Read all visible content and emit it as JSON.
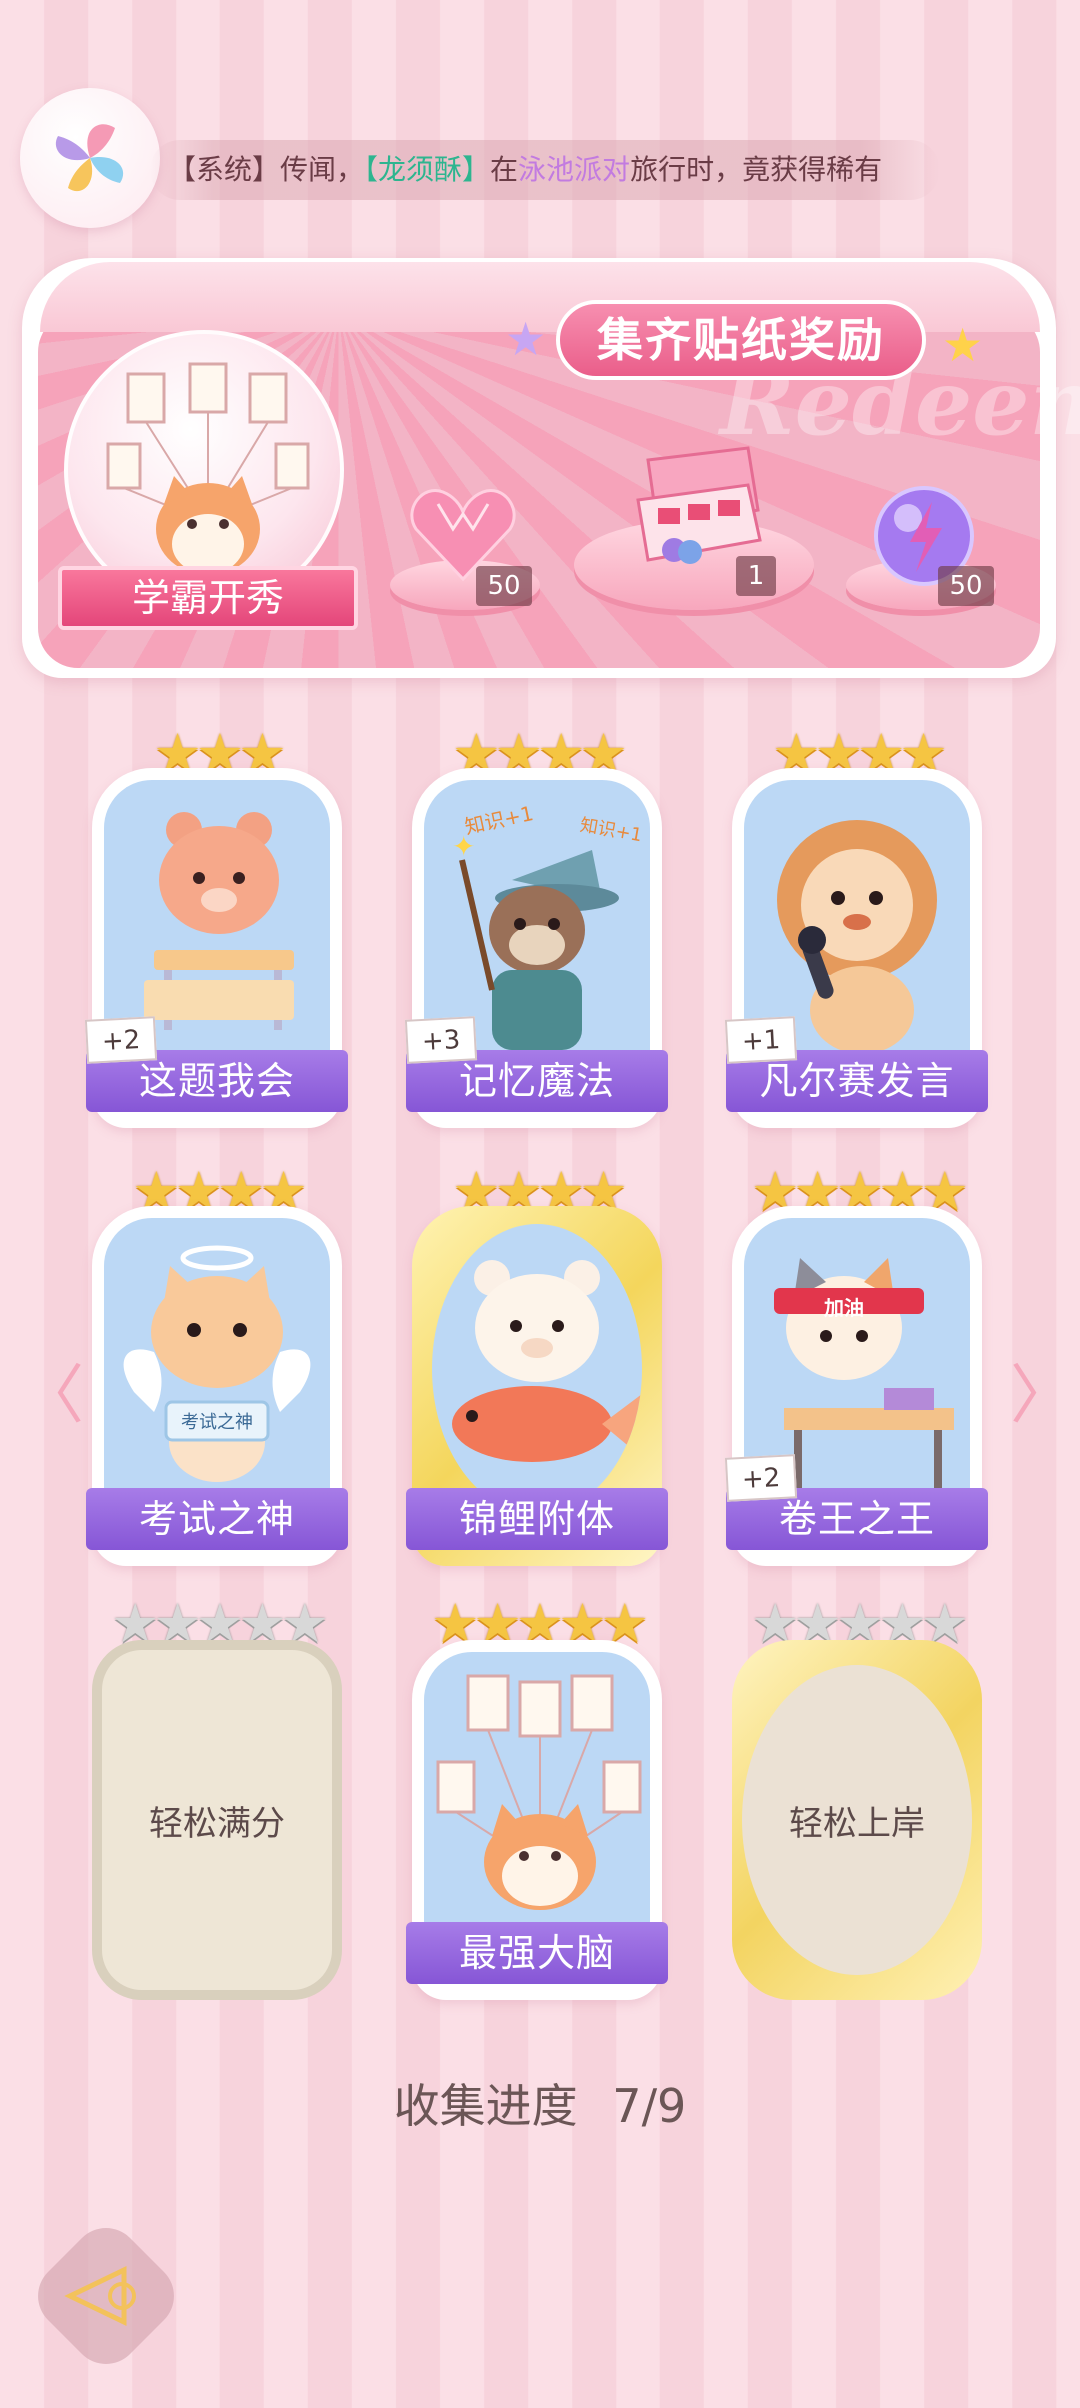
{
  "ticker": {
    "part1": "【系统】传闻，",
    "name": "【龙须酥】",
    "part2": "在",
    "place": "泳池派对",
    "part3": "旅行时，竟获得稀有"
  },
  "banner": {
    "title": "集齐贴纸奖励",
    "watermark": "Redeem",
    "ribbon_label": "学霸开秀",
    "rewards": [
      {
        "icon": "pink-diamond-heart-icon",
        "count": "50"
      },
      {
        "icon": "gift-box-icon",
        "count": "1"
      },
      {
        "icon": "purple-energy-orb-icon",
        "count": "50"
      }
    ]
  },
  "stickers": [
    {
      "label": "这题我会",
      "stars": 3,
      "badge": "+2",
      "icon": "bear-at-desk-icon"
    },
    {
      "label": "记忆魔法",
      "stars": 4,
      "badge": "+3",
      "icon": "wizard-otter-icon",
      "art_text": "知识+1"
    },
    {
      "label": "凡尔赛发言",
      "stars": 4,
      "badge": "+1",
      "icon": "lion-microphone-icon"
    },
    {
      "label": "考试之神",
      "stars": 4,
      "badge": "",
      "icon": "angel-cat-icon",
      "art_text": "考试之神"
    },
    {
      "label": "锦鲤附体",
      "stars": 4,
      "badge": "",
      "icon": "bear-koi-icon"
    },
    {
      "label": "卷王之王",
      "stars": 5,
      "badge": "+2",
      "icon": "cat-headband-study-icon",
      "art_text": "加油"
    },
    {
      "label": "轻松满分",
      "stars": 5,
      "locked": true
    },
    {
      "label": "最强大脑",
      "stars": 5,
      "badge": "",
      "icon": "cat-papers-icon"
    },
    {
      "label": "轻松上岸",
      "stars": 5,
      "locked": true
    }
  ],
  "progress": {
    "label": "收集进度",
    "value": "7/9"
  },
  "colors": {
    "accent": "#8656d6",
    "banner": "#ea5e8a",
    "star": "#f5c542"
  }
}
